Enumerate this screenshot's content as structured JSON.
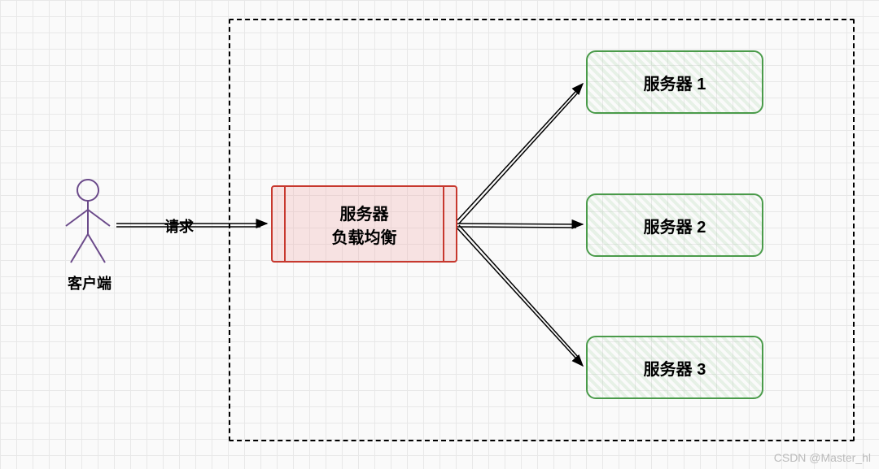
{
  "diagram": {
    "client_label": "客户端",
    "request_label": "请求",
    "load_balancer_line1": "服务器",
    "load_balancer_line2": "负载均衡",
    "servers": [
      "服务器 1",
      "服务器 2",
      "服务器 3"
    ]
  },
  "watermark": "CSDN @Master_hl"
}
